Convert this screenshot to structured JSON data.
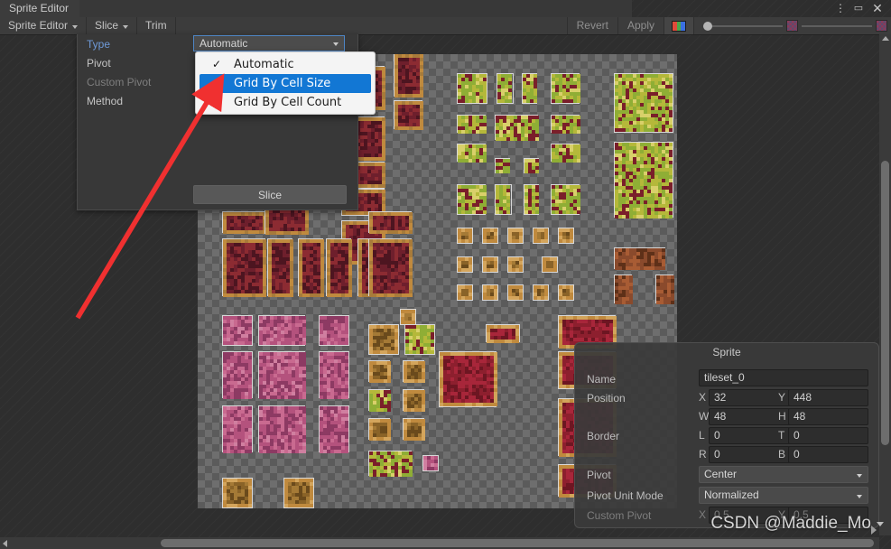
{
  "window": {
    "title": "Sprite Editor",
    "controls": {
      "menu": "⋮",
      "maximize": "▭",
      "close": "✕"
    }
  },
  "tabs": [
    {
      "label": "Sprite Editor"
    }
  ],
  "toolbar": {
    "left_items": [
      {
        "label": "Sprite Editor",
        "has_caret": true
      },
      {
        "label": "Slice",
        "has_caret": true
      },
      {
        "label": "Trim",
        "has_caret": false
      }
    ],
    "revert_label": "Revert",
    "apply_label": "Apply",
    "rgb_icon": "rgb-channels-icon",
    "alpha_icon": "checker-alpha-icon",
    "slider_value": 0
  },
  "slice_panel": {
    "rows": [
      {
        "label": "Type",
        "state": "highlighted"
      },
      {
        "label": "Pivot",
        "state": "normal"
      },
      {
        "label": "Custom Pivot",
        "state": "disabled"
      },
      {
        "label": "Method",
        "state": "normal"
      }
    ],
    "type_value": "Automatic",
    "slice_button": "Slice"
  },
  "dropdown": {
    "options": [
      {
        "label": "Automatic",
        "checked": true,
        "highlighted": false
      },
      {
        "label": "Grid By Cell Size",
        "checked": false,
        "highlighted": true
      },
      {
        "label": "Grid By Cell Count",
        "checked": false,
        "highlighted": false
      }
    ]
  },
  "sprite_panel": {
    "title": "Sprite",
    "name_label": "Name",
    "name_value": "tileset_0",
    "position_label": "Position",
    "pos_x_prefix": "X",
    "pos_x_value": "32",
    "pos_y_prefix": "Y",
    "pos_y_value": "448",
    "pos_w_prefix": "W",
    "pos_w_value": "48",
    "pos_h_prefix": "H",
    "pos_h_value": "48",
    "border_label": "Border",
    "border_l_prefix": "L",
    "border_l_value": "0",
    "border_t_prefix": "T",
    "border_t_value": "0",
    "border_r_prefix": "R",
    "border_r_value": "0",
    "border_b_prefix": "B",
    "border_b_value": "0",
    "pivot_label": "Pivot",
    "pivot_value": "Center",
    "pivot_unit_label": "Pivot Unit Mode",
    "pivot_unit_value": "Normalized",
    "custom_pivot_label": "Custom Pivot",
    "custom_x_prefix": "X",
    "custom_x_value": "0.5",
    "custom_y_prefix": "Y",
    "custom_y_value": "0.5"
  },
  "annotation": {
    "arrow_color": "#f03030"
  },
  "watermark": {
    "text": "CSDN @Maddie_Mo"
  },
  "colors": {
    "bg": "#2b2b2b",
    "panel": "#383838",
    "accent_blue": "#1277d4",
    "field_blue_border": "#4e85c4",
    "label_blue": "#6f9ad8"
  }
}
